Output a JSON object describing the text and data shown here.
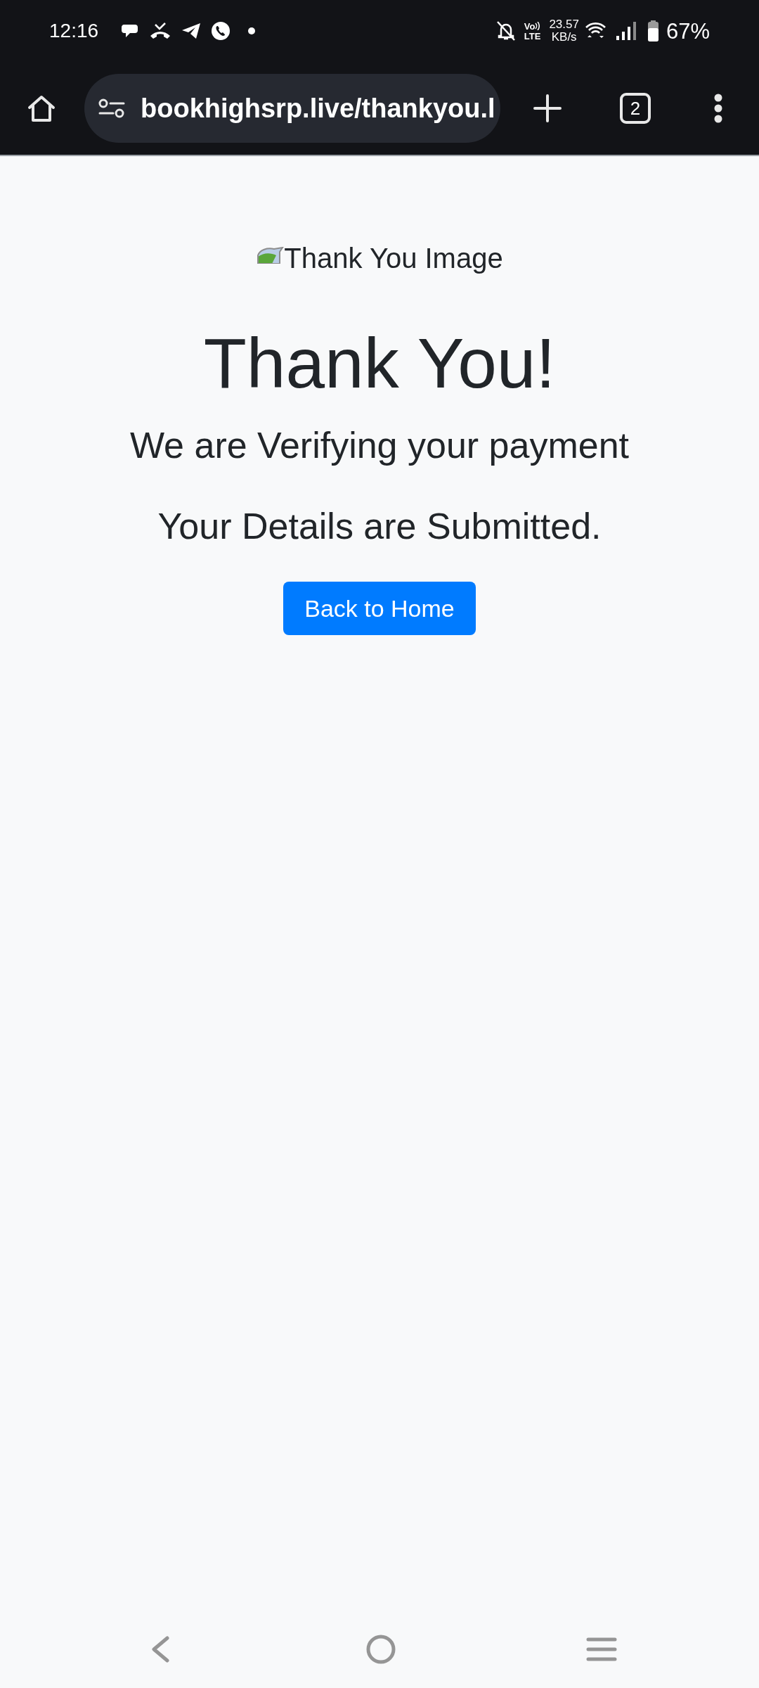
{
  "status_bar": {
    "time": "12:16",
    "volte": {
      "top": "Vo",
      "bottom": "LTE"
    },
    "speed": "23.57",
    "speed_unit": "KB/s",
    "battery": "67%"
  },
  "browser": {
    "url": "bookhighsrp.live/thankyou.l",
    "tab_count": "2"
  },
  "page": {
    "image_alt": "Thank You Image",
    "heading": "Thank You!",
    "message": "We are Verifying your payment",
    "note": "Your Details are Submitted.",
    "button": "Back to Home"
  }
}
